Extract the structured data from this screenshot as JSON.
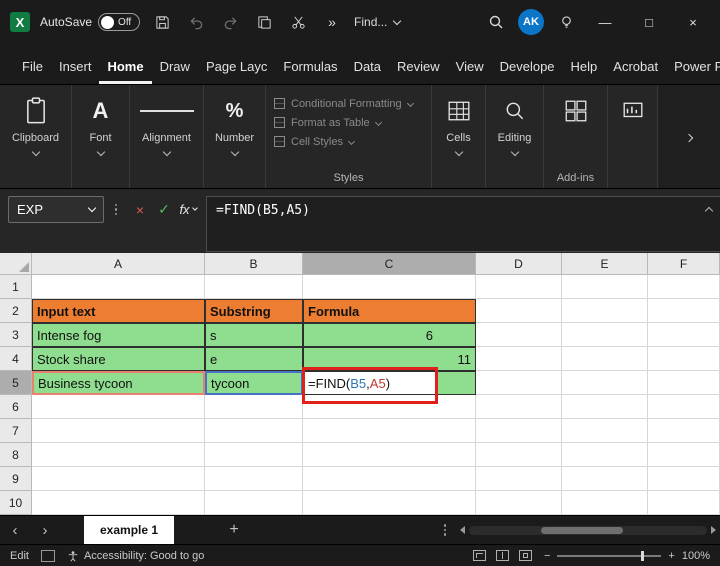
{
  "colors": {
    "excel_green": "#107C41",
    "header_orange": "#ED7D31",
    "cell_green": "#8FDD8F",
    "ref_blue": "#2E75B6",
    "ref_red": "#C0392B",
    "annotation_red": "#E0201A",
    "avatar_blue": "#0B76C8"
  },
  "title_bar": {
    "autosave_label": "AutoSave",
    "autosave_state": "Off",
    "find_label": "Find...",
    "avatar": "AK",
    "minimize": "—",
    "maximize": "□",
    "close": "×",
    "overflow": "»"
  },
  "menu": {
    "tabs": [
      "File",
      "Insert",
      "Home",
      "Draw",
      "Page Layc",
      "Formulas",
      "Data",
      "Review",
      "View",
      "Develope",
      "Help",
      "Acrobat",
      "Power Piv"
    ],
    "active_tab": "Home"
  },
  "ribbon": {
    "groups": [
      {
        "label": "Clipboard"
      },
      {
        "label": "Font"
      },
      {
        "label": "Alignment"
      },
      {
        "label": "Number"
      }
    ],
    "styles_group": {
      "label": "Styles",
      "buttons": [
        "Conditional Formatting",
        "Format as Table",
        "Cell Styles"
      ]
    },
    "cells_label": "Cells",
    "editing_label": "Editing",
    "addins_label": "Add-ins",
    "font_glyph": "A",
    "number_glyph": "%"
  },
  "formula_bar": {
    "name_box": "EXP",
    "formula": "=FIND(B5,A5)"
  },
  "grid": {
    "col_headers": [
      "A",
      "B",
      "C",
      "D",
      "E",
      "F"
    ],
    "row_headers": [
      "1",
      "2",
      "3",
      "4",
      "5",
      "6",
      "7",
      "8",
      "9",
      "10"
    ],
    "active_col": "C",
    "active_row": "5",
    "cells": {
      "a2": "Input text",
      "b2": "Substring",
      "c2": "Formula",
      "a3": "Intense fog",
      "b3": "s",
      "c3": "6",
      "a4": "Stock share",
      "b4": "e",
      "c4": "11",
      "a5": "Business tycoon",
      "b5": "tycoon",
      "c5_formula": {
        "p1": "=FIND(",
        "ref1": "B5",
        "p2": ",",
        "ref2": "A5",
        "p3": ")"
      }
    }
  },
  "sheet_tabs": {
    "active": "example 1",
    "add_label": "+"
  },
  "status_bar": {
    "mode": "Edit",
    "accessibility": "Accessibility: Good to go",
    "zoom": "100%"
  }
}
